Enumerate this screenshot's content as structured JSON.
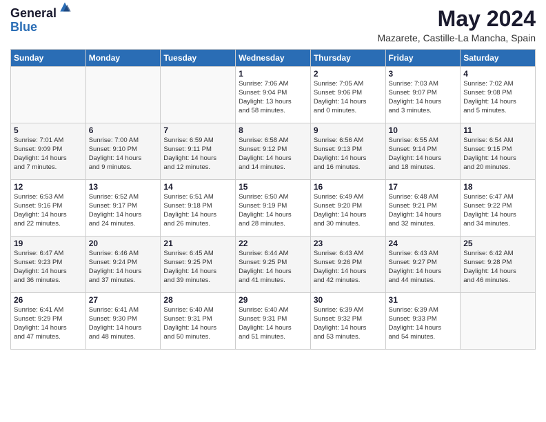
{
  "logo": {
    "general": "General",
    "blue": "Blue"
  },
  "header": {
    "month_year": "May 2024",
    "location": "Mazarete, Castille-La Mancha, Spain"
  },
  "weekdays": [
    "Sunday",
    "Monday",
    "Tuesday",
    "Wednesday",
    "Thursday",
    "Friday",
    "Saturday"
  ],
  "weeks": [
    [
      {
        "num": "",
        "info": ""
      },
      {
        "num": "",
        "info": ""
      },
      {
        "num": "",
        "info": ""
      },
      {
        "num": "1",
        "info": "Sunrise: 7:06 AM\nSunset: 9:04 PM\nDaylight: 13 hours\nand 58 minutes."
      },
      {
        "num": "2",
        "info": "Sunrise: 7:05 AM\nSunset: 9:06 PM\nDaylight: 14 hours\nand 0 minutes."
      },
      {
        "num": "3",
        "info": "Sunrise: 7:03 AM\nSunset: 9:07 PM\nDaylight: 14 hours\nand 3 minutes."
      },
      {
        "num": "4",
        "info": "Sunrise: 7:02 AM\nSunset: 9:08 PM\nDaylight: 14 hours\nand 5 minutes."
      }
    ],
    [
      {
        "num": "5",
        "info": "Sunrise: 7:01 AM\nSunset: 9:09 PM\nDaylight: 14 hours\nand 7 minutes."
      },
      {
        "num": "6",
        "info": "Sunrise: 7:00 AM\nSunset: 9:10 PM\nDaylight: 14 hours\nand 9 minutes."
      },
      {
        "num": "7",
        "info": "Sunrise: 6:59 AM\nSunset: 9:11 PM\nDaylight: 14 hours\nand 12 minutes."
      },
      {
        "num": "8",
        "info": "Sunrise: 6:58 AM\nSunset: 9:12 PM\nDaylight: 14 hours\nand 14 minutes."
      },
      {
        "num": "9",
        "info": "Sunrise: 6:56 AM\nSunset: 9:13 PM\nDaylight: 14 hours\nand 16 minutes."
      },
      {
        "num": "10",
        "info": "Sunrise: 6:55 AM\nSunset: 9:14 PM\nDaylight: 14 hours\nand 18 minutes."
      },
      {
        "num": "11",
        "info": "Sunrise: 6:54 AM\nSunset: 9:15 PM\nDaylight: 14 hours\nand 20 minutes."
      }
    ],
    [
      {
        "num": "12",
        "info": "Sunrise: 6:53 AM\nSunset: 9:16 PM\nDaylight: 14 hours\nand 22 minutes."
      },
      {
        "num": "13",
        "info": "Sunrise: 6:52 AM\nSunset: 9:17 PM\nDaylight: 14 hours\nand 24 minutes."
      },
      {
        "num": "14",
        "info": "Sunrise: 6:51 AM\nSunset: 9:18 PM\nDaylight: 14 hours\nand 26 minutes."
      },
      {
        "num": "15",
        "info": "Sunrise: 6:50 AM\nSunset: 9:19 PM\nDaylight: 14 hours\nand 28 minutes."
      },
      {
        "num": "16",
        "info": "Sunrise: 6:49 AM\nSunset: 9:20 PM\nDaylight: 14 hours\nand 30 minutes."
      },
      {
        "num": "17",
        "info": "Sunrise: 6:48 AM\nSunset: 9:21 PM\nDaylight: 14 hours\nand 32 minutes."
      },
      {
        "num": "18",
        "info": "Sunrise: 6:47 AM\nSunset: 9:22 PM\nDaylight: 14 hours\nand 34 minutes."
      }
    ],
    [
      {
        "num": "19",
        "info": "Sunrise: 6:47 AM\nSunset: 9:23 PM\nDaylight: 14 hours\nand 36 minutes."
      },
      {
        "num": "20",
        "info": "Sunrise: 6:46 AM\nSunset: 9:24 PM\nDaylight: 14 hours\nand 37 minutes."
      },
      {
        "num": "21",
        "info": "Sunrise: 6:45 AM\nSunset: 9:25 PM\nDaylight: 14 hours\nand 39 minutes."
      },
      {
        "num": "22",
        "info": "Sunrise: 6:44 AM\nSunset: 9:25 PM\nDaylight: 14 hours\nand 41 minutes."
      },
      {
        "num": "23",
        "info": "Sunrise: 6:43 AM\nSunset: 9:26 PM\nDaylight: 14 hours\nand 42 minutes."
      },
      {
        "num": "24",
        "info": "Sunrise: 6:43 AM\nSunset: 9:27 PM\nDaylight: 14 hours\nand 44 minutes."
      },
      {
        "num": "25",
        "info": "Sunrise: 6:42 AM\nSunset: 9:28 PM\nDaylight: 14 hours\nand 46 minutes."
      }
    ],
    [
      {
        "num": "26",
        "info": "Sunrise: 6:41 AM\nSunset: 9:29 PM\nDaylight: 14 hours\nand 47 minutes."
      },
      {
        "num": "27",
        "info": "Sunrise: 6:41 AM\nSunset: 9:30 PM\nDaylight: 14 hours\nand 48 minutes."
      },
      {
        "num": "28",
        "info": "Sunrise: 6:40 AM\nSunset: 9:31 PM\nDaylight: 14 hours\nand 50 minutes."
      },
      {
        "num": "29",
        "info": "Sunrise: 6:40 AM\nSunset: 9:31 PM\nDaylight: 14 hours\nand 51 minutes."
      },
      {
        "num": "30",
        "info": "Sunrise: 6:39 AM\nSunset: 9:32 PM\nDaylight: 14 hours\nand 53 minutes."
      },
      {
        "num": "31",
        "info": "Sunrise: 6:39 AM\nSunset: 9:33 PM\nDaylight: 14 hours\nand 54 minutes."
      },
      {
        "num": "",
        "info": ""
      }
    ]
  ]
}
